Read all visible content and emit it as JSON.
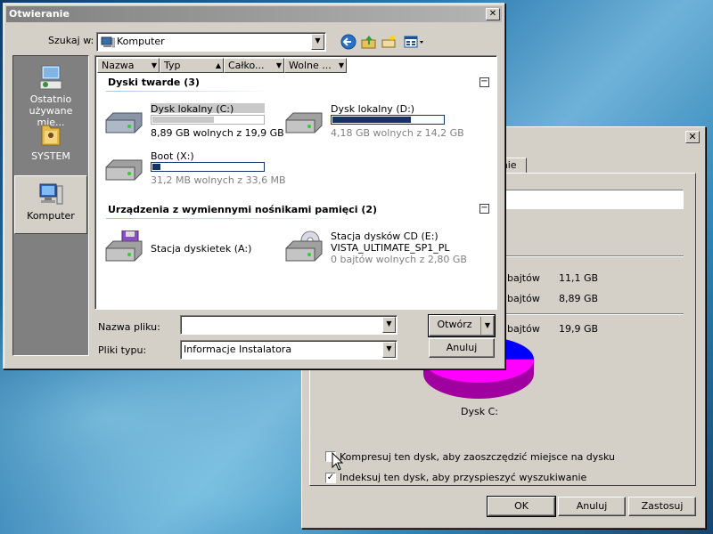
{
  "properties_dialog": {
    "tab_fragment": "anie",
    "rows": [
      {
        "unit": "bajtów",
        "gb": "11,1 GB"
      },
      {
        "unit": "bajtów",
        "gb": "8,89 GB"
      },
      {
        "unit": "bajtów",
        "gb": "19,9 GB"
      }
    ],
    "disk_label": "Dysk C:",
    "pie": {
      "used_fraction": 0.553,
      "used_color": "#ff00ff",
      "free_color": "#0000ff"
    },
    "compress_label": "Kompresuj ten dysk, aby zaoszczędzić miejsce na dysku",
    "compress_checked": false,
    "index_label": "Indeksuj ten dysk, aby przyspieszyć wyszukiwanie",
    "index_checked": true,
    "check_mark": "✓",
    "buttons": {
      "ok": "OK",
      "cancel": "Anuluj",
      "apply": "Zastosuj"
    },
    "close_glyph": "✕"
  },
  "open_dialog": {
    "title": "Otwieranie",
    "close_glyph": "✕",
    "look_in_label": "Szukaj w:",
    "look_in_value": "Komputer",
    "toolbar_icons": [
      "back-icon",
      "up-folder-icon",
      "new-folder-icon",
      "view-menu-icon"
    ],
    "places": [
      {
        "label": "Ostatnio używane mie...",
        "icon": "recent-places-icon",
        "selected": false
      },
      {
        "label": "SYSTEM",
        "icon": "user-folder-icon",
        "selected": false
      },
      {
        "label": "Komputer",
        "icon": "computer-icon",
        "selected": true
      }
    ],
    "columns": [
      "Nazwa",
      "Typ",
      "Całko...",
      "Wolne ..."
    ],
    "groups": [
      {
        "title": "Dyski twarde (3)",
        "toggle": "−",
        "drives": [
          {
            "name": "Dysk lokalny (C:)",
            "free": "8,89 GB wolnych z 19,9 GB",
            "used_fraction": 0.553,
            "selected": true
          },
          {
            "name": "Dysk lokalny (D:)",
            "free": "4,18 GB wolnych z 14,2 GB",
            "used_fraction": 0.706,
            "selected": false
          },
          {
            "name": "Boot (X:)",
            "free": "31,2 MB wolnych z 33,6 MB",
            "used_fraction": 0.071,
            "selected": false
          }
        ]
      },
      {
        "title": "Urządzenia z wymiennymi nośnikami pamięci (2)",
        "toggle": "−",
        "drives": [
          {
            "name": "Stacja dyskietek (A:)"
          },
          {
            "name": "Stacja dysków CD (E:)",
            "volume": "VISTA_ULTIMATE_SP1_PL",
            "free": "0 bajtów wolnych z 2,80 GB"
          }
        ]
      }
    ],
    "filename_label": "Nazwa pliku:",
    "filename_value": "",
    "filetype_label": "Pliki typu:",
    "filetype_value": "Informacje Instalatora",
    "open_button": "Otwórz",
    "cancel_button": "Anuluj"
  }
}
